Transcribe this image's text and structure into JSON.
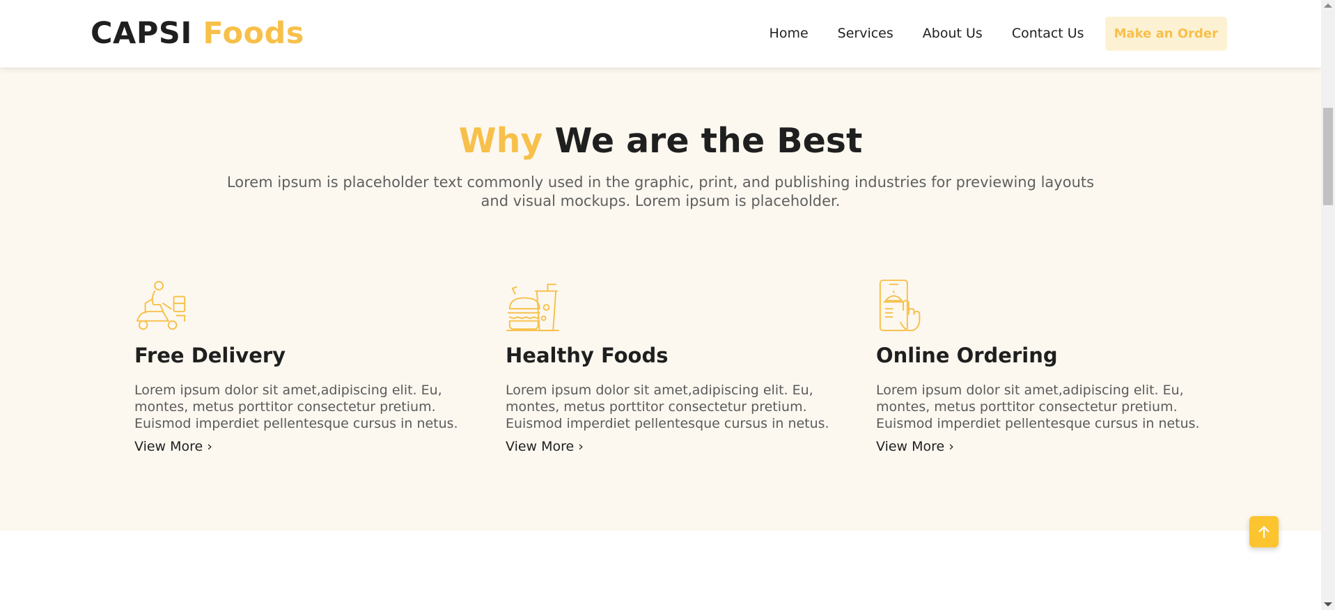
{
  "brand": {
    "name": "CAPSI",
    "accent": "Foods",
    "accent_color": "#f7c04a"
  },
  "nav": {
    "items": [
      "Home",
      "Services",
      "About Us",
      "Contact Us"
    ],
    "cta": "Make an Order"
  },
  "section": {
    "title_accent": "Why",
    "title_rest": "We are the Best",
    "subtitle": "Lorem ipsum is placeholder text commonly used in the graphic, print, and publishing industries for previewing layouts and visual mockups. Lorem ipsum is placeholder."
  },
  "features": [
    {
      "icon": "delivery-scooter-icon",
      "title": "Free Delivery",
      "text": "Lorem ipsum dolor sit amet,adipiscing elit. Eu, montes, metus porttitor consectetur pretium. Euismod imperdiet pellentesque cursus in netus.",
      "link": "View More"
    },
    {
      "icon": "burger-drink-icon",
      "title": "Healthy Foods",
      "text": "Lorem ipsum dolor sit amet,adipiscing elit. Eu, montes, metus porttitor consectetur pretium. Euismod imperdiet pellentesque cursus in netus.",
      "link": "View More"
    },
    {
      "icon": "phone-order-icon",
      "title": "Online Ordering",
      "text": "Lorem ipsum dolor sit amet,adipiscing elit. Eu, montes, metus porttitor consectetur pretium. Euismod imperdiet pellentesque cursus in netus.",
      "link": "View More"
    }
  ],
  "back_to_top_icon": "arrow-up-icon"
}
